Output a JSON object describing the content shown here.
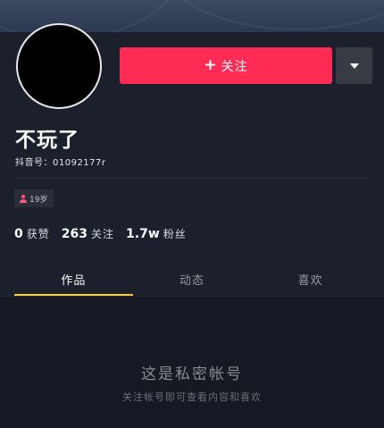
{
  "profile": {
    "nickname": "不玩了",
    "douyin_id": "抖音号：01092177r",
    "tag_label": "19岁"
  },
  "actions": {
    "follow_plus": "+",
    "follow_label": "关注",
    "more_icon": "triangle-down-icon"
  },
  "stats": [
    {
      "num": "0",
      "label": "获赞"
    },
    {
      "num": "263",
      "label": "关注"
    },
    {
      "num": "1.7w",
      "label": "粉丝"
    }
  ],
  "tabs": [
    {
      "label": "作品",
      "active": true
    },
    {
      "label": "动态",
      "active": false
    },
    {
      "label": "喜欢",
      "active": false
    }
  ],
  "empty_state": {
    "title": "这是私密帐号",
    "subtitle": "关注帐号即可查看内容和喜欢"
  },
  "colors": {
    "accent": "#fe2c55",
    "tab_indicator": "#face15",
    "background": "#161823"
  }
}
